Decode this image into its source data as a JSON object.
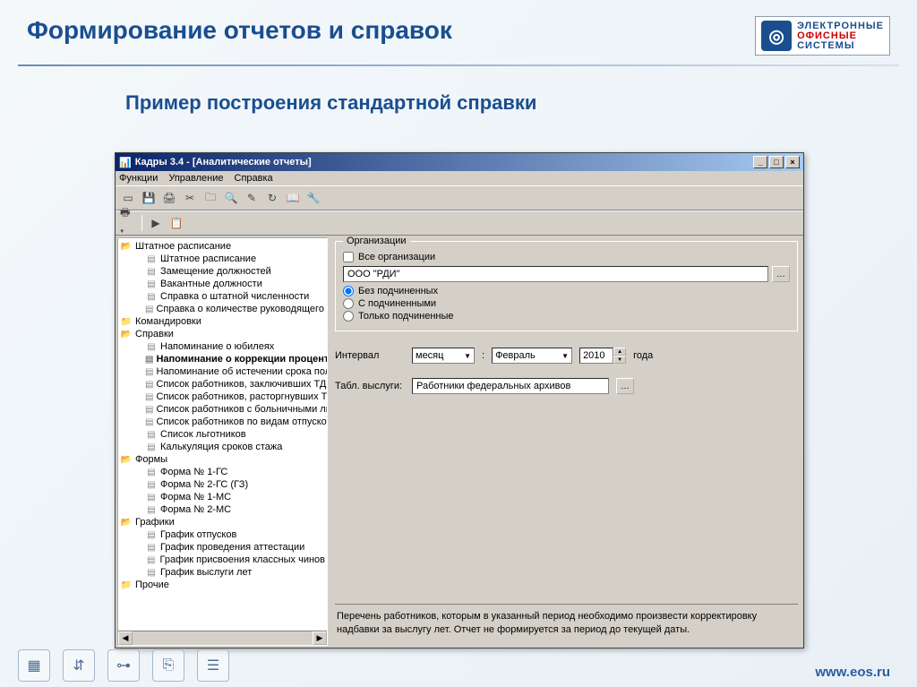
{
  "slide": {
    "title": "Формирование отчетов и справок",
    "subtitle": "Пример построения стандартной справки"
  },
  "logo": {
    "l1": "ЭЛЕКТРОННЫЕ",
    "l2": "ОФИСНЫЕ",
    "l3": "СИСТЕМЫ"
  },
  "footer_url": "www.eos.ru",
  "window": {
    "title": "Кадры 3.4 - [Аналитические отчеты]",
    "menu": {
      "functions": "Функции",
      "manage": "Управление",
      "help": "Справка"
    }
  },
  "tree": {
    "n0": "Штатное расписание",
    "n0_0": "Штатное расписание",
    "n0_1": "Замещение должностей",
    "n0_2": "Вакантные должности",
    "n0_3": "Справка о штатной численности",
    "n0_4": "Справка о количестве руководящего сос",
    "n1": "Командировки",
    "n2": "Справки",
    "n2_0": "Напоминание о юбилеях",
    "n2_1": "Напоминание о коррекции процента",
    "n2_2": "Напоминание об истечении срока полном",
    "n2_3": "Список работников, заключивших ТД",
    "n2_4": "Список работников, расторгнувших ТД",
    "n2_5": "Список работников с больничными листа",
    "n2_6": "Список работников по видам отпусков",
    "n2_7": "Список льготников",
    "n2_8": "Калькуляция сроков стажа",
    "n3": "Формы",
    "n3_0": "Форма № 1-ГС",
    "n3_1": "Форма № 2-ГС (ГЗ)",
    "n3_2": "Форма № 1-МС",
    "n3_3": "Форма № 2-МС",
    "n4": "Графики",
    "n4_0": "График отпусков",
    "n4_1": "График проведения аттестации",
    "n4_2": "График присвоения классных чинов",
    "n4_3": "График выслуги лет",
    "n5": "Прочие"
  },
  "form": {
    "org_group": "Организации",
    "all_orgs": "Все организации",
    "org_value": "ООО \"РДИ\"",
    "r_without": "Без подчиненных",
    "r_with": "С подчиненными",
    "r_only": "Только подчиненные",
    "interval_label": "Интервал",
    "interval_unit": "месяц",
    "month": "Февраль",
    "year": "2010",
    "year_suffix": "года",
    "table_label": "Табл. выслуги:",
    "table_value": "Работники федеральных архивов",
    "description": "Перечень работников, которым в указанный период необходимо произвести корректировку надбавки за выслугу лет. Отчет не формируется за период до текущей даты."
  }
}
